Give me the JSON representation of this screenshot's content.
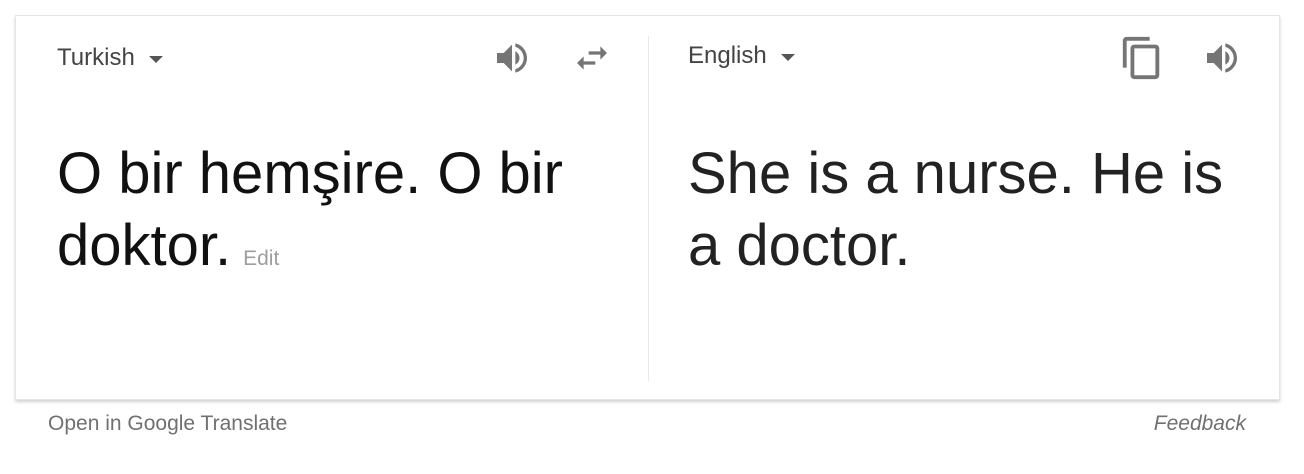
{
  "source": {
    "language": "Turkish",
    "text": "O bir hemşire. O bir doktor.",
    "edit_label": "Edit"
  },
  "target": {
    "language": "English",
    "text": "She is a nurse. He is a doctor."
  },
  "icons": {
    "source_speaker": "speaker-icon",
    "swap": "swap-languages-icon",
    "copy": "copy-icon",
    "target_speaker": "speaker-icon"
  },
  "footer": {
    "open_link": "Open in Google Translate",
    "feedback": "Feedback"
  },
  "colors": {
    "icon": "#757575",
    "text": "#111111",
    "muted": "#9e9e9e"
  }
}
